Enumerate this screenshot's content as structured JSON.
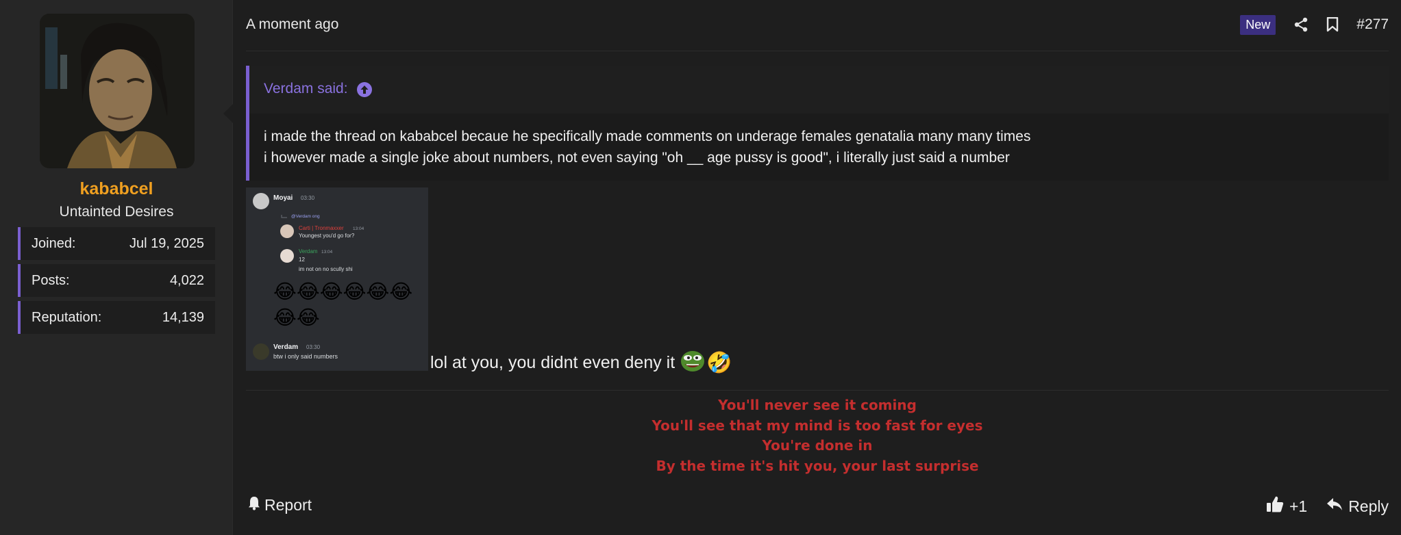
{
  "user": {
    "username": "kababcel",
    "user_title": "Untainted Desires",
    "stats": [
      {
        "label": "Joined:",
        "value": "Jul 19, 2025"
      },
      {
        "label": "Posts:",
        "value": "4,022"
      },
      {
        "label": "Reputation:",
        "value": "14,139"
      }
    ]
  },
  "post": {
    "timestamp": "A moment ago",
    "new_badge": "New",
    "post_number": "#277",
    "quote": {
      "author_label": "Verdam said:",
      "lines": [
        "i made the thread on kababcel becaue he specifically made comments on underage females genatalia many many times",
        "i however made a single joke about numbers, not even saying \"oh __ age pussy is good\", i literally just said a number"
      ]
    },
    "screenshot": {
      "msg1_author": "Moyai",
      "msg1_time": "03:30",
      "reply_ref": "@Verdam ong",
      "nested1_author": "Carti | Tronmaxxer",
      "nested1_time": "13:04",
      "nested1_text": "Youngest you'd go for?",
      "nested2_author": "Verdam",
      "nested2_time": "13:04",
      "nested2_text1": "12",
      "nested2_text2": "im not on no scully shi",
      "emoji_row1": "😂😂😂😂😂😂",
      "emoji_row2": "😂😂",
      "msg2_author": "Verdam",
      "msg2_time": "03:30",
      "msg2_text": "btw i only said numbers"
    },
    "body_text": "lol at you, you didnt even deny it",
    "body_emoji": "🤣",
    "signature": [
      "You'll never see it coming",
      "You'll see that my mind is too fast for eyes",
      "You're done in",
      "By the time it's hit you, your last surprise"
    ]
  },
  "footer": {
    "report_label": "Report",
    "reaction_count": "+1",
    "reply_label": "Reply"
  },
  "colors": {
    "accent": "#7a5fd0",
    "username": "#f0a020",
    "signature": "#c42e2e",
    "new_badge_bg": "#3b2f80"
  },
  "icons": [
    "share-icon",
    "bookmark-icon",
    "arrow-up-circle-icon",
    "bell-icon",
    "thumbs-up-icon",
    "reply-icon",
    "pepe-emoji",
    "rofl-emoji"
  ]
}
